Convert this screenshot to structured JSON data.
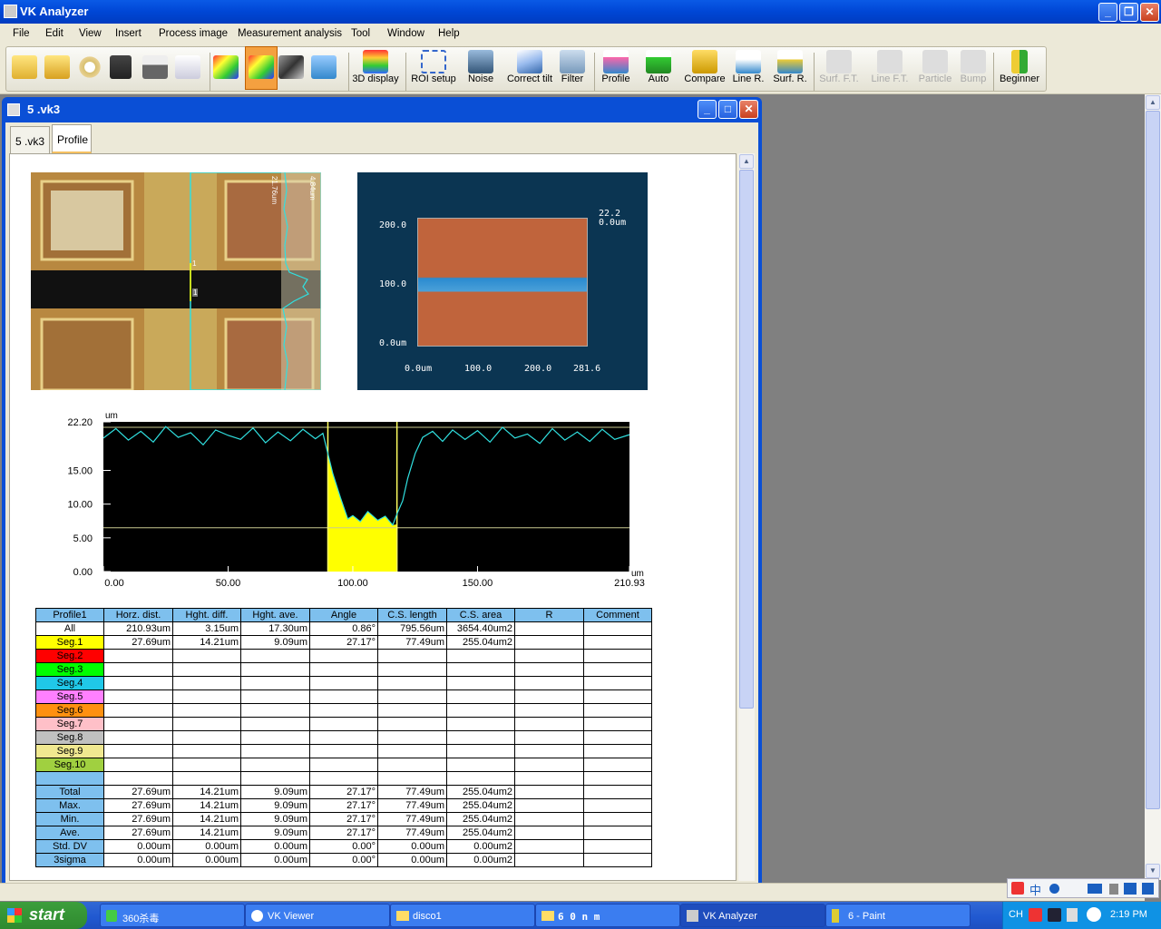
{
  "app": {
    "title": "VK Analyzer"
  },
  "menu": [
    "File",
    "Edit",
    "View",
    "Insert",
    "Process image",
    "Measurement analysis",
    "Tool",
    "Window",
    "Help"
  ],
  "toolbar": {
    "buttons": [
      {
        "label": "3D display",
        "icon": "3d-display-icon",
        "enabled": true
      },
      {
        "label": "ROI setup",
        "icon": "roi-setup-icon",
        "enabled": true
      },
      {
        "label": "Noise",
        "icon": "noise-icon",
        "enabled": true
      },
      {
        "label": "Correct tilt",
        "icon": "correct-tilt-icon",
        "enabled": true
      },
      {
        "label": "Filter",
        "icon": "filter-icon",
        "enabled": true
      },
      {
        "label": "Profile",
        "icon": "profile-icon",
        "enabled": true
      },
      {
        "label": "Auto",
        "icon": "auto-icon",
        "enabled": true
      },
      {
        "label": "Compare",
        "icon": "compare-icon",
        "enabled": true
      },
      {
        "label": "Line R.",
        "icon": "line-roughness-icon",
        "enabled": true
      },
      {
        "label": "Surf. R.",
        "icon": "surface-roughness-icon",
        "enabled": true
      },
      {
        "label": "Surf. F.T.",
        "icon": "surface-ft-icon",
        "enabled": false
      },
      {
        "label": "Line F.T.",
        "icon": "line-ft-icon",
        "enabled": false
      },
      {
        "label": "Particle",
        "icon": "particle-icon",
        "enabled": false
      },
      {
        "label": "Bump",
        "icon": "bump-icon",
        "enabled": false
      },
      {
        "label": "Beginner",
        "icon": "beginner-icon",
        "enabled": true
      }
    ]
  },
  "doc": {
    "title": "5 .vk3",
    "tabs": [
      {
        "label": "5 .vk3",
        "active": false
      },
      {
        "label": "Profile",
        "active": true
      }
    ]
  },
  "micro": {
    "scale_left": "21.76um",
    "scale_right": "4.84um",
    "cursor1": "1",
    "cursor2": "1"
  },
  "map3d": {
    "top_label": "22.2",
    "top_unit": "0.0um",
    "y_ticks": [
      "200.0",
      "100.0",
      "0.0um"
    ],
    "x_ticks": [
      "0.0um",
      "100.0",
      "200.0",
      "281.6"
    ]
  },
  "chart_data": {
    "type": "line",
    "yunit": "um",
    "xunit": "um",
    "xlim": [
      0,
      210.93
    ],
    "ylim": [
      0,
      22.2
    ],
    "y_ticks": [
      "22.20",
      "15.00",
      "10.00",
      "5.00",
      "0.00"
    ],
    "x_ticks": [
      "0.00",
      "50.00",
      "100.00",
      "150.00",
      "210.93"
    ],
    "cursors": [
      90,
      117.7
    ],
    "ref_lines": [
      21.4,
      6.5
    ],
    "series": [
      {
        "x": [
          0,
          5,
          10,
          15,
          20,
          25,
          30,
          35,
          40,
          45,
          50,
          55,
          60,
          65,
          70,
          75,
          80,
          85,
          88,
          90,
          92,
          95,
          98,
          100,
          103,
          106,
          110,
          113,
          116,
          118,
          120,
          122,
          125,
          128,
          132,
          136,
          140,
          145,
          150,
          155,
          160,
          165,
          170,
          175,
          180,
          185,
          190,
          195,
          200,
          205,
          210.93
        ],
        "y": [
          19.8,
          21.2,
          19.5,
          20.8,
          19.2,
          21.5,
          19.9,
          20.6,
          18.8,
          21.0,
          20.2,
          19.6,
          21.3,
          19.1,
          20.7,
          19.4,
          21.1,
          19.7,
          20.5,
          17.5,
          14.5,
          11.0,
          7.8,
          8.3,
          7.4,
          8.9,
          7.6,
          8.2,
          6.9,
          8.8,
          10.5,
          13.8,
          17.5,
          19.9,
          20.8,
          19.3,
          21.0,
          19.6,
          20.9,
          19.2,
          21.4,
          19.8,
          20.4,
          19.0,
          21.2,
          19.5,
          20.7,
          19.3,
          21.1,
          19.6,
          20.3
        ]
      }
    ]
  },
  "table": {
    "headers": [
      "Profile1",
      "Horz. dist.",
      "Hght. diff.",
      "Hght. ave.",
      "Angle",
      "C.S. length",
      "C.S. area",
      "R",
      "Comment"
    ],
    "seg_rows": [
      {
        "label": "All",
        "color": "#ffffff",
        "vals": [
          "210.93um",
          "3.15um",
          "17.30um",
          "0.86°",
          "795.56um",
          "3654.40um2",
          "",
          ""
        ]
      },
      {
        "label": "Seg.1",
        "color": "#ffff00",
        "vals": [
          "27.69um",
          "14.21um",
          "9.09um",
          "27.17°",
          "77.49um",
          "255.04um2",
          "",
          ""
        ]
      },
      {
        "label": "Seg.2",
        "color": "#ff0000",
        "vals": [
          "",
          "",
          "",
          "",
          "",
          "",
          "",
          ""
        ]
      },
      {
        "label": "Seg.3",
        "color": "#00ff00",
        "vals": [
          "",
          "",
          "",
          "",
          "",
          "",
          "",
          ""
        ]
      },
      {
        "label": "Seg.4",
        "color": "#20c8e8",
        "vals": [
          "",
          "",
          "",
          "",
          "",
          "",
          "",
          ""
        ]
      },
      {
        "label": "Seg.5",
        "color": "#ff80ff",
        "vals": [
          "",
          "",
          "",
          "",
          "",
          "",
          "",
          ""
        ]
      },
      {
        "label": "Seg.6",
        "color": "#ff9010",
        "vals": [
          "",
          "",
          "",
          "",
          "",
          "",
          "",
          ""
        ]
      },
      {
        "label": "Seg.7",
        "color": "#ffc0c8",
        "vals": [
          "",
          "",
          "",
          "",
          "",
          "",
          "",
          ""
        ]
      },
      {
        "label": "Seg.8",
        "color": "#c0c0c0",
        "vals": [
          "",
          "",
          "",
          "",
          "",
          "",
          "",
          ""
        ]
      },
      {
        "label": "Seg.9",
        "color": "#f0e890",
        "vals": [
          "",
          "",
          "",
          "",
          "",
          "",
          "",
          ""
        ]
      },
      {
        "label": "Seg.10",
        "color": "#a0d040",
        "vals": [
          "",
          "",
          "",
          "",
          "",
          "",
          "",
          ""
        ]
      },
      {
        "label": "",
        "color": "#7ec0ee",
        "vals": [
          "",
          "",
          "",
          "",
          "",
          "",
          "",
          ""
        ]
      }
    ],
    "stat_rows": [
      {
        "label": "Total",
        "vals": [
          "27.69um",
          "14.21um",
          "9.09um",
          "27.17°",
          "77.49um",
          "255.04um2",
          "",
          ""
        ]
      },
      {
        "label": "Max.",
        "vals": [
          "27.69um",
          "14.21um",
          "9.09um",
          "27.17°",
          "77.49um",
          "255.04um2",
          "",
          ""
        ]
      },
      {
        "label": "Min.",
        "vals": [
          "27.69um",
          "14.21um",
          "9.09um",
          "27.17°",
          "77.49um",
          "255.04um2",
          "",
          ""
        ]
      },
      {
        "label": "Ave.",
        "vals": [
          "27.69um",
          "14.21um",
          "9.09um",
          "27.17°",
          "77.49um",
          "255.04um2",
          "",
          ""
        ]
      },
      {
        "label": "Std. DV",
        "vals": [
          "0.00um",
          "0.00um",
          "0.00um",
          "0.00°",
          "0.00um",
          "0.00um2",
          "",
          ""
        ]
      },
      {
        "label": "3sigma",
        "vals": [
          "0.00um",
          "0.00um",
          "0.00um",
          "0.00°",
          "0.00um",
          "0.00um2",
          "",
          ""
        ]
      }
    ]
  },
  "taskbar": {
    "start": "start",
    "tasks": [
      {
        "label": "360杀毒",
        "icon": "shield-icon"
      },
      {
        "label": "VK Viewer",
        "icon": "vk-viewer-icon"
      },
      {
        "label": "disco1",
        "icon": "folder-icon"
      },
      {
        "label": "6 0 n m",
        "icon": "folder-icon"
      },
      {
        "label": "VK Analyzer",
        "icon": "vk-analyzer-icon",
        "active": true
      },
      {
        "label": "6 - Paint",
        "icon": "paint-icon"
      }
    ],
    "lang": "CH",
    "clock": "2:19 PM"
  },
  "ime": {
    "chars": "中"
  }
}
